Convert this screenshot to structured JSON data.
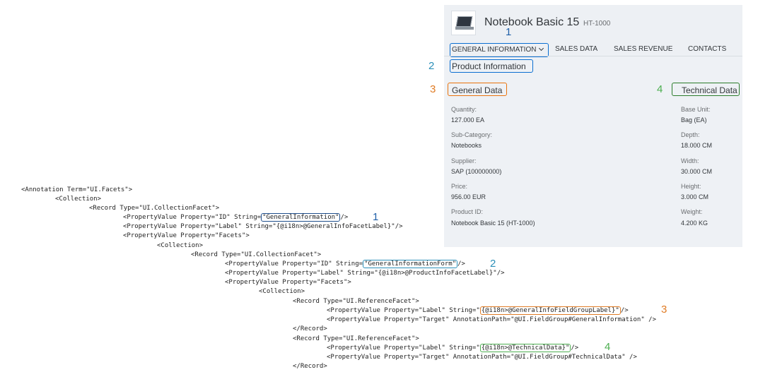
{
  "header": {
    "title": "Notebook Basic 15",
    "subtitle": "HT-1000"
  },
  "tabs": [
    {
      "label": "GENERAL INFORMATION"
    },
    {
      "label": "SALES DATA"
    },
    {
      "label": "SALES REVENUE"
    },
    {
      "label": "CONTACTS"
    }
  ],
  "sections": {
    "product_info": "Product Information",
    "general_data": "General Data",
    "technical_data": "Technical Data"
  },
  "general_fields": [
    {
      "label": "Quantity:",
      "value": "127.000 EA"
    },
    {
      "label": "Sub-Category:",
      "value": "Notebooks"
    },
    {
      "label": "Supplier:",
      "value": "SAP (100000000)"
    },
    {
      "label": "Price:",
      "value": "956.00  EUR"
    },
    {
      "label": "Product ID:",
      "value": "Notebook Basic 15 (HT-1000)"
    }
  ],
  "technical_fields": [
    {
      "label": "Base Unit:",
      "value": "Bag (EA)"
    },
    {
      "label": "Depth:",
      "value": "18.000 CM"
    },
    {
      "label": "Width:",
      "value": "30.000 CM"
    },
    {
      "label": "Height:",
      "value": "3.000 CM"
    },
    {
      "label": "Weight:",
      "value": "4.200 KG"
    }
  ],
  "callouts": {
    "one": "1",
    "two": "2",
    "three": "3",
    "four": "4"
  },
  "code": {
    "l1": "<Annotation Term=\"UI.Facets\">",
    "l2": "<Collection>",
    "l3": "<Record Type=\"UI.CollectionFacet\">",
    "l4_pre": "<PropertyValue Property=\"ID\" String=",
    "l4_hl": "\"GeneralInformation\"",
    "l4_post": "/>",
    "l5": "<PropertyValue Property=\"Label\" String=\"{@i18n>@GeneralInfoFacetLabel}\"/>",
    "l6": "<PropertyValue Property=\"Facets\">",
    "l7": "<Collection>",
    "l8": "<Record Type=\"UI.CollectionFacet\">",
    "l9_pre": "<PropertyValue Property=\"ID\" String=",
    "l9_hl": "\"GeneralInformationForm\"",
    "l9_post": "/>",
    "l10": "<PropertyValue Property=\"Label\" String=\"{@i18n>@ProductInfoFacetLabel}\"/>",
    "l11": "<PropertyValue Property=\"Facets\">",
    "l12": "<Collection>",
    "l13": "<Record Type=\"UI.ReferenceFacet\">",
    "l14_pre": "<PropertyValue Property=\"Label\" String=\"",
    "l14_hl": "{@i18n>@GeneralInfoFieldGroupLabel}\"",
    "l14_post": "/>",
    "l15": "<PropertyValue Property=\"Target\" AnnotationPath=\"@UI.FieldGroup#GeneralInformation\" />",
    "l16": "</Record>",
    "l17": "<Record Type=\"UI.ReferenceFacet\">",
    "l18_pre": "<PropertyValue Property=\"Label\" String=\"",
    "l18_hl": "{@i18n>@TechnicalData}\"",
    "l18_post": "/>",
    "l19": "<PropertyValue Property=\"Target\" AnnotationPath=\"@UI.FieldGroup#TechnicalData\" />",
    "l20": "</Record>"
  }
}
